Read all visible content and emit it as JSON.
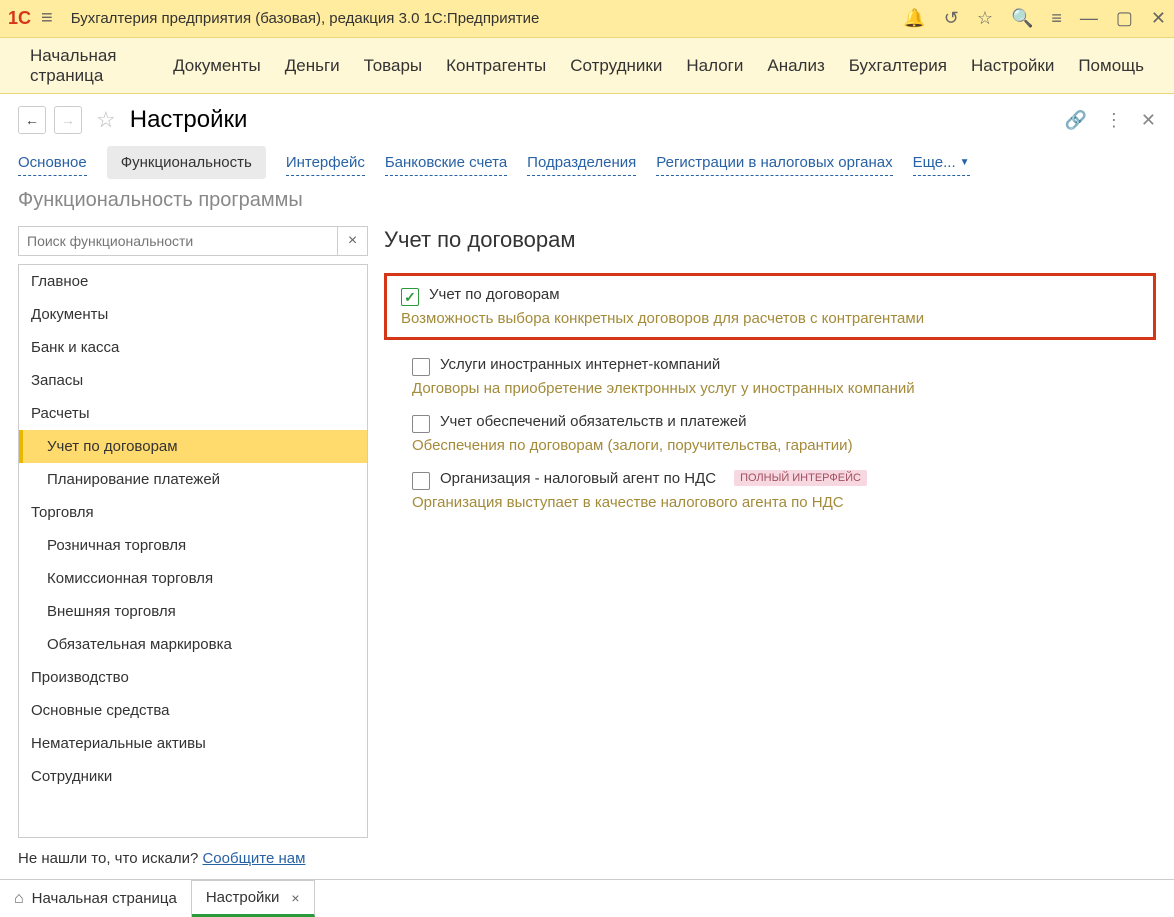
{
  "app": {
    "title": "Бухгалтерия предприятия (базовая), редакция 3.0 1С:Предприятие"
  },
  "menubar": [
    "Начальная страница",
    "Документы",
    "Деньги",
    "Товары",
    "Контрагенты",
    "Сотрудники",
    "Налоги",
    "Анализ",
    "Бухгалтерия",
    "Настройки",
    "Помощь"
  ],
  "page": {
    "title": "Настройки"
  },
  "tabs": {
    "items": [
      "Основное",
      "Функциональность",
      "Интерфейс",
      "Банковские счета",
      "Подразделения",
      "Регистрации в налоговых органах"
    ],
    "more": "Еще...",
    "active_index": 1
  },
  "func": {
    "section_title": "Функциональность программы",
    "search_placeholder": "Поиск функциональности",
    "tree": [
      {
        "label": "Главное",
        "sub": false
      },
      {
        "label": "Документы",
        "sub": false
      },
      {
        "label": "Банк и касса",
        "sub": false
      },
      {
        "label": "Запасы",
        "sub": false
      },
      {
        "label": "Расчеты",
        "sub": false
      },
      {
        "label": "Учет по договорам",
        "sub": true,
        "selected": true
      },
      {
        "label": "Планирование платежей",
        "sub": true
      },
      {
        "label": "Торговля",
        "sub": false
      },
      {
        "label": "Розничная торговля",
        "sub": true
      },
      {
        "label": "Комиссионная торговля",
        "sub": true
      },
      {
        "label": "Внешняя торговля",
        "sub": true
      },
      {
        "label": "Обязательная маркировка",
        "sub": true
      },
      {
        "label": "Производство",
        "sub": false
      },
      {
        "label": "Основные средства",
        "sub": false
      },
      {
        "label": "Нематериальные активы",
        "sub": false
      },
      {
        "label": "Сотрудники",
        "sub": false
      }
    ]
  },
  "detail": {
    "title": "Учет по договорам",
    "main_option": {
      "label": "Учет по договорам",
      "desc": "Возможность выбора конкретных договоров для расчетов с контрагентами"
    },
    "options": [
      {
        "label": "Услуги иностранных интернет-компаний",
        "desc": "Договоры на приобретение электронных услуг у иностранных компаний"
      },
      {
        "label": "Учет обеспечений обязательств и платежей",
        "desc": "Обеспечения по договорам (залоги, поручительства, гарантии)"
      },
      {
        "label": "Организация - налоговый агент по НДС",
        "desc": "Организация выступает в качестве налогового агента по НДС",
        "badge": "ПОЛНЫЙ ИНТЕРФЕЙС"
      }
    ]
  },
  "footer": {
    "prompt": "Не нашли то, что искали?  ",
    "link": "Сообщите нам"
  },
  "bottom_tabs": {
    "home": "Начальная страница",
    "current": "Настройки"
  }
}
